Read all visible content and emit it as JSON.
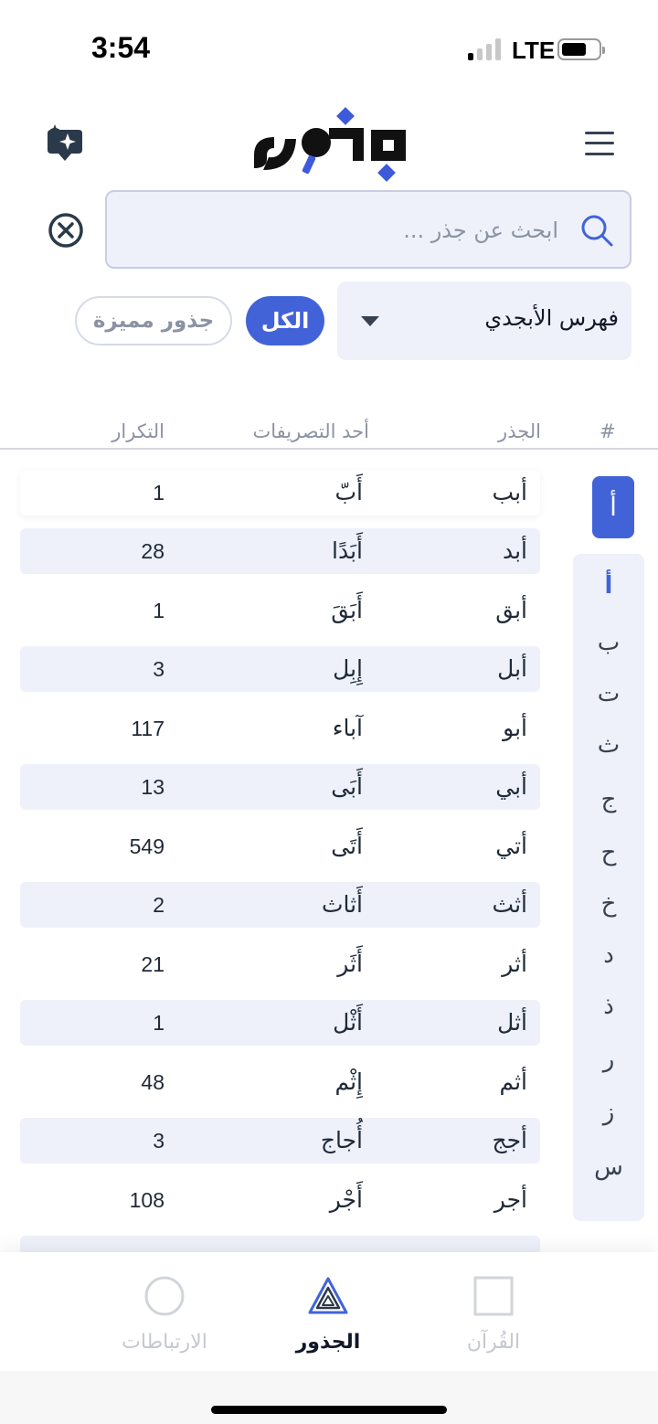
{
  "status_bar": {
    "time": "3:54",
    "network": "LTE"
  },
  "search": {
    "placeholder": "ابحث عن جذر ..."
  },
  "filters": {
    "index_label": "فهرس الأبجدي",
    "all_label": "الكل",
    "featured_label": "جذور مميزة"
  },
  "table": {
    "headers": {
      "num": "#",
      "root": "الجذر",
      "form": "أحد التصريفات",
      "count": "التكرار"
    },
    "rows": [
      {
        "root": "أبب",
        "form": "أَبّ",
        "count": "1"
      },
      {
        "root": "أبد",
        "form": "أَبَدًا",
        "count": "28"
      },
      {
        "root": "أبق",
        "form": "أَبَقَ",
        "count": "1"
      },
      {
        "root": "أبل",
        "form": "إِبِل",
        "count": "3"
      },
      {
        "root": "أبو",
        "form": "آباء",
        "count": "117"
      },
      {
        "root": "أبي",
        "form": "أَبَى",
        "count": "13"
      },
      {
        "root": "أتي",
        "form": "أَتَى",
        "count": "549"
      },
      {
        "root": "أثث",
        "form": "أَثاث",
        "count": "2"
      },
      {
        "root": "أثر",
        "form": "أَثَر",
        "count": "21"
      },
      {
        "root": "أثل",
        "form": "أَثْل",
        "count": "1"
      },
      {
        "root": "أثم",
        "form": "إِثْم",
        "count": "48"
      },
      {
        "root": "أجج",
        "form": "أُجاج",
        "count": "3"
      },
      {
        "root": "أجر",
        "form": "أَجْر",
        "count": "108"
      }
    ]
  },
  "alphabet": {
    "active": "أ",
    "letters": [
      "أ",
      "ب",
      "ت",
      "ث",
      "ج",
      "ح",
      "خ",
      "د",
      "ذ",
      "ر",
      "ز",
      "س"
    ]
  },
  "bottom_nav": {
    "connections": "الارتباطات",
    "roots": "الجذور",
    "quran": "القُرآن"
  },
  "colors": {
    "accent": "#4263d8",
    "row_shade": "#eef1fa",
    "muted": "#8b93a3"
  }
}
